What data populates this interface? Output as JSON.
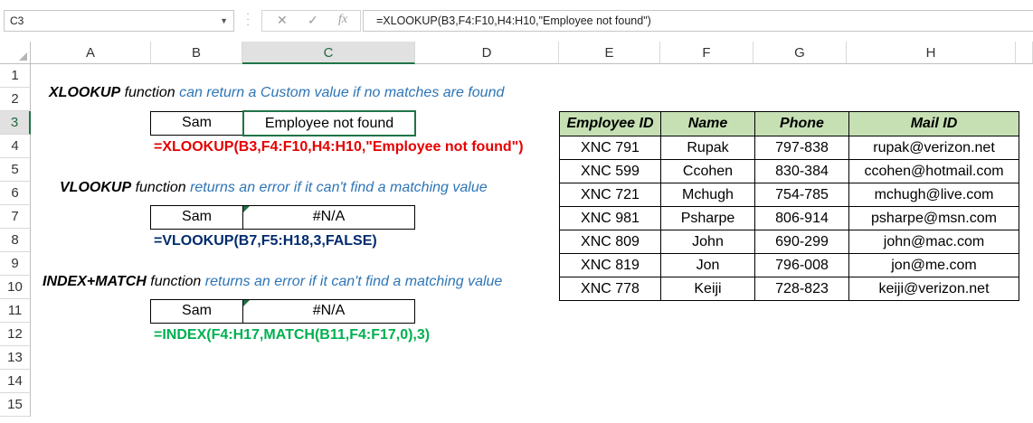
{
  "formula_bar": {
    "name_box": "C3",
    "cancel_icon": "✕",
    "enter_icon": "✓",
    "fx_icon": "fx",
    "formula": "=XLOOKUP(B3,F4:F10,H4:H10,\"Employee not found\")"
  },
  "columns": [
    "A",
    "B",
    "C",
    "D",
    "E",
    "F",
    "G",
    "H"
  ],
  "rows": [
    "1",
    "2",
    "3",
    "4",
    "5",
    "6",
    "7",
    "8",
    "9",
    "10",
    "11",
    "12",
    "13",
    "14",
    "15"
  ],
  "selected": {
    "column": "C",
    "row": "3"
  },
  "xlookup": {
    "title_bold": "XLOOKUP",
    "title_fn": " function ",
    "title_desc": "can return a Custom value if no matches are found",
    "lookup": "Sam",
    "result": "Employee not found",
    "formula": "=XLOOKUP(B3,F4:F10,H4:H10,\"Employee not found\")",
    "formula_color": "#e60000"
  },
  "vlookup": {
    "title_bold": "VLOOKUP",
    "title_fn": " function ",
    "title_desc": "returns an error if it can't find a matching value",
    "lookup": "Sam",
    "result": "#N/A",
    "formula": "=VLOOKUP(B7,F5:H18,3,FALSE)",
    "formula_color": "#002b6e"
  },
  "indexmatch": {
    "title_bold": "INDEX+MATCH",
    "title_fn": " function ",
    "title_desc": "returns an error if it can't find a matching value",
    "lookup": "Sam",
    "result": "#N/A",
    "formula": "=INDEX(F4:H17,MATCH(B11,F4:F17,0),3)",
    "formula_color": "#00b050"
  },
  "table": {
    "headers": [
      "Employee ID",
      "Name",
      "Phone",
      "Mail ID"
    ],
    "header_bg": "#c6e0b4",
    "rows": [
      [
        "XNC 791",
        "Rupak",
        "797-838",
        "rupak@verizon.net"
      ],
      [
        "XNC 599",
        "Ccohen",
        "830-384",
        "ccohen@hotmail.com"
      ],
      [
        "XNC 721",
        "Mchugh",
        "754-785",
        "mchugh@live.com"
      ],
      [
        "XNC 981",
        "Psharpe",
        "806-914",
        "psharpe@msn.com"
      ],
      [
        "XNC 809",
        "John",
        "690-299",
        "john@mac.com"
      ],
      [
        "XNC 819",
        "Jon",
        "796-008",
        "jon@me.com"
      ],
      [
        "XNC 778",
        "Keiji",
        "728-823",
        "keiji@verizon.net"
      ]
    ]
  }
}
